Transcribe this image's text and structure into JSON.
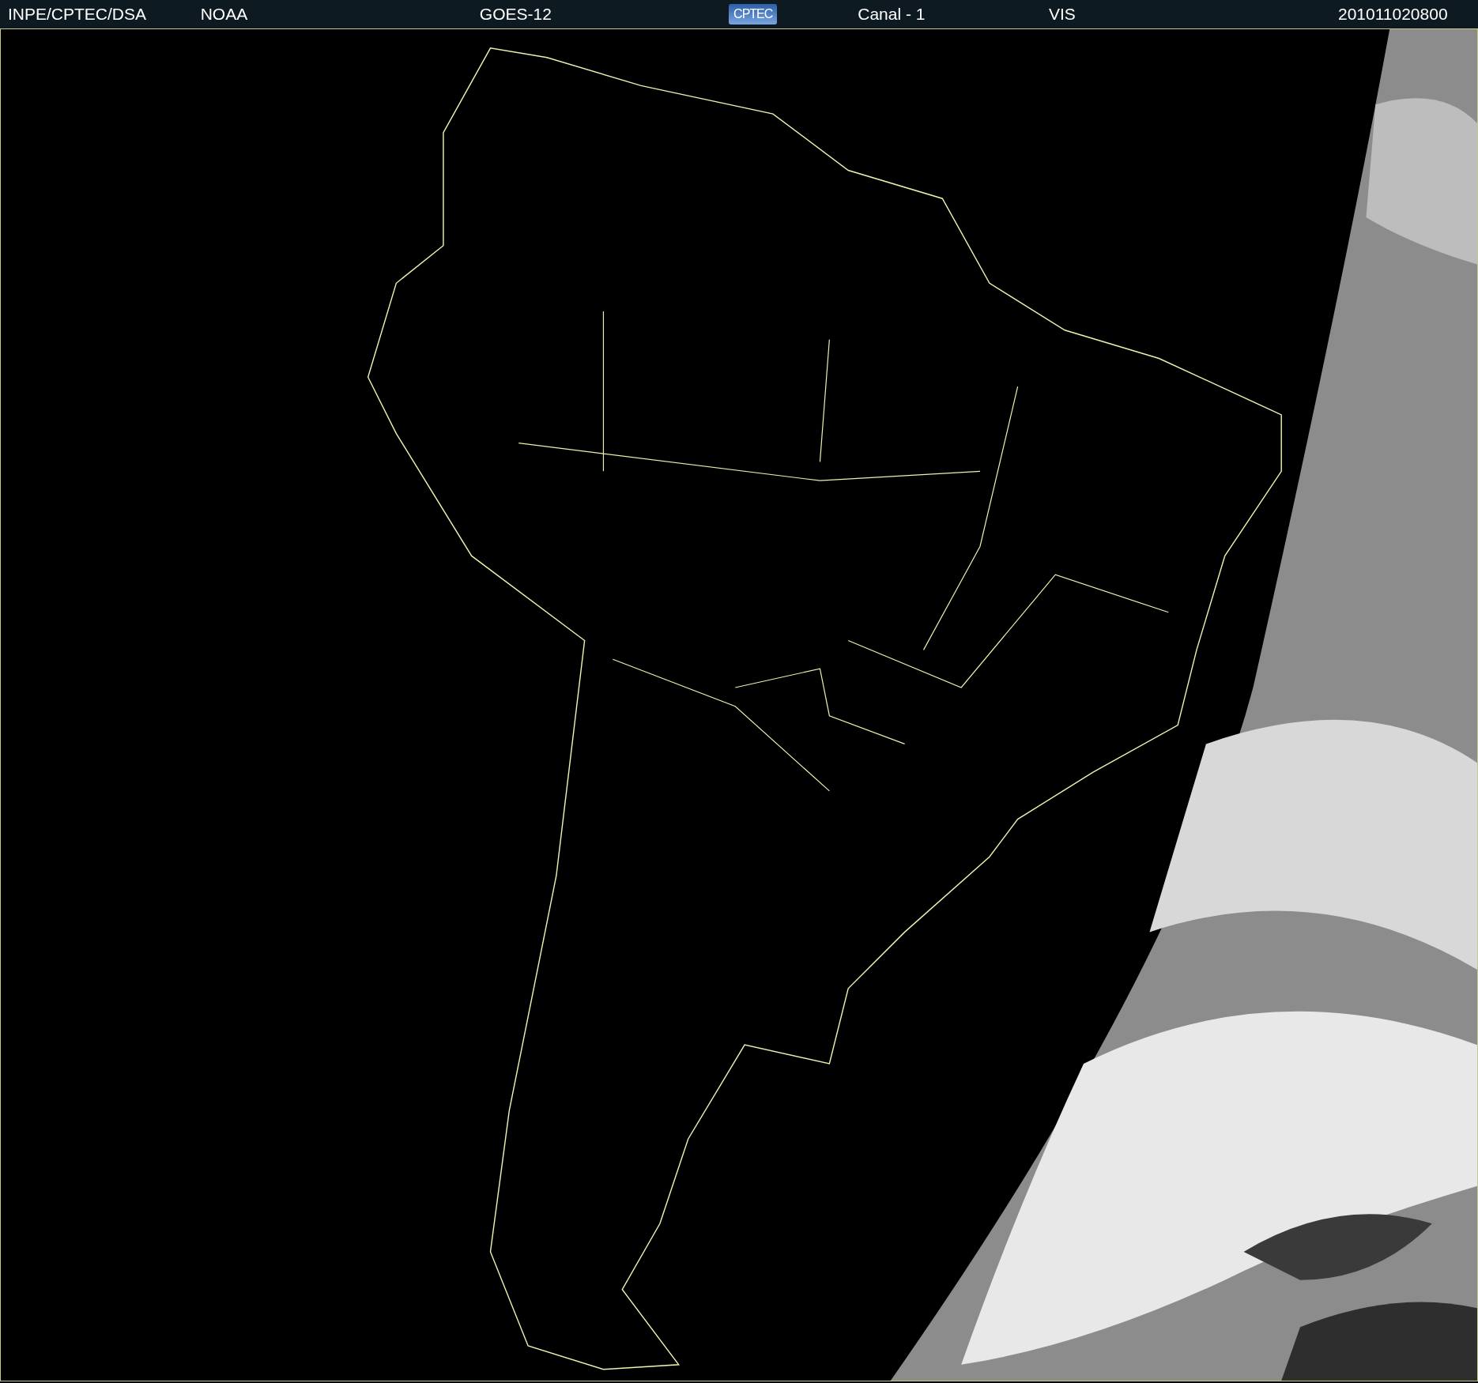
{
  "header": {
    "items": [
      {
        "kind": "text",
        "text": "INPE/CPTEC/DSA"
      },
      {
        "kind": "text",
        "text": "NOAA"
      },
      {
        "kind": "text",
        "text": "GOES-12"
      },
      {
        "kind": "logo",
        "text": "CPTEC"
      },
      {
        "kind": "text",
        "text": "Canal - 1"
      },
      {
        "kind": "text",
        "text": "VIS"
      },
      {
        "kind": "text",
        "text": "201011020800"
      }
    ]
  }
}
